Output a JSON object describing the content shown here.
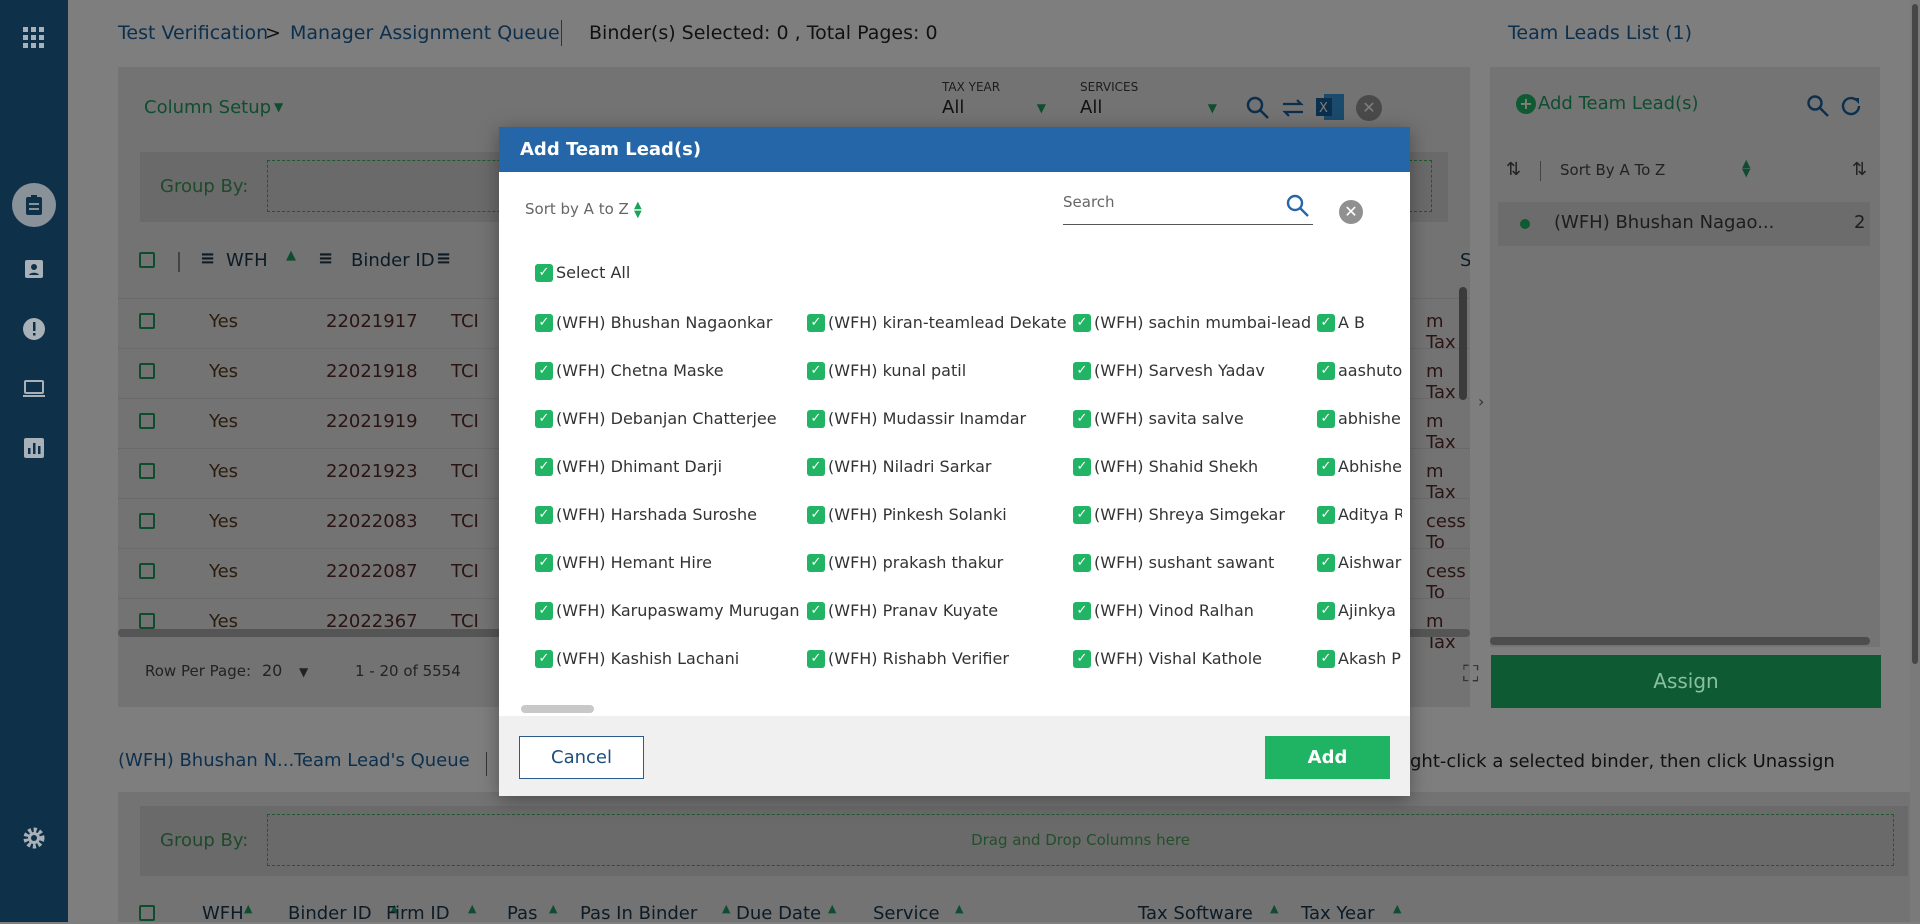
{
  "rail": {
    "icons": [
      "apps-icon",
      "assignment-icon",
      "assignment-ind-icon",
      "alert-icon",
      "laptop-icon",
      "chart-icon",
      "gear-icon"
    ]
  },
  "breadcrumb": {
    "part1": "Test Verification",
    "separator": ">",
    "part2": "Manager Assignment Queue",
    "selected": "Binder(s) Selected: 0 , Total Pages: 0"
  },
  "toolbar": {
    "column_setup": "Column Setup",
    "tax_year_label": "TAX YEAR",
    "tax_year_value": "All",
    "services_label": "SERVICES",
    "services_value": "All"
  },
  "grid": {
    "group_by": "Group By:",
    "headers": {
      "wfh": "WFH",
      "binder_id": "Binder ID",
      "softw": "Softw"
    },
    "rows": [
      {
        "wfh": "Yes",
        "binder": "22021917",
        "firm": "TCI",
        "soft": "m Tax"
      },
      {
        "wfh": "Yes",
        "binder": "22021918",
        "firm": "TCI",
        "soft": "m Tax"
      },
      {
        "wfh": "Yes",
        "binder": "22021919",
        "firm": "TCI",
        "soft": "m Tax"
      },
      {
        "wfh": "Yes",
        "binder": "22021923",
        "firm": "TCI",
        "soft": "m Tax"
      },
      {
        "wfh": "Yes",
        "binder": "22022083",
        "firm": "TCI",
        "soft": "cess To"
      },
      {
        "wfh": "Yes",
        "binder": "22022087",
        "firm": "TCI",
        "soft": "cess To"
      },
      {
        "wfh": "Yes",
        "binder": "22022367",
        "firm": "TCI",
        "soft": "m Tax"
      }
    ],
    "row_per_page_label": "Row Per Page:",
    "row_per_page": "20",
    "range": "1 - 20 of 5554"
  },
  "right_panel": {
    "title": "Team Leads List (1)",
    "add": "Add Team Lead(s)",
    "sort": "Sort By A To Z",
    "item_name": "(WFH) Bhushan Nagao...",
    "item_count": "2",
    "assign": "Assign"
  },
  "bottom": {
    "lead": "(WFH) Bhushan N...",
    "queue": "Team Lead's Queue",
    "hint": "ght-click a selected binder, then click Unassign",
    "group_by": "Group By:",
    "drop": "Drag and Drop Columns here",
    "headers": [
      "WFH",
      "Binder ID",
      "Firm ID",
      "Pas",
      "Pas In Binder",
      "Due Date",
      "Service",
      "Tax Software",
      "Tax Year"
    ]
  },
  "modal": {
    "title": "Add Team Lead(s)",
    "sort": "Sort by A to Z",
    "search_placeholder": "Search",
    "select_all": "Select All",
    "columns": [
      [
        "(WFH) Bhushan Nagaonkar",
        "(WFH) Chetna Maske",
        "(WFH) Debanjan Chatterjee",
        "(WFH) Dhimant Darji",
        "(WFH) Harshada Suroshe",
        "(WFH) Hemant Hire",
        "(WFH) Karupaswamy Murugan",
        "(WFH) Kashish Lachani"
      ],
      [
        "(WFH) kiran-teamlead Dekate",
        "(WFH) kunal patil",
        "(WFH) Mudassir Inamdar",
        "(WFH) Niladri Sarkar",
        "(WFH) Pinkesh Solanki",
        "(WFH) prakash thakur",
        "(WFH) Pranav Kuyate",
        "(WFH) Rishabh Verifier"
      ],
      [
        "(WFH) sachin mumbai-lead",
        "(WFH) Sarvesh Yadav",
        "(WFH) savita salve",
        "(WFH) Shahid Shekh",
        "(WFH) Shreya Simgekar",
        "(WFH) sushant sawant",
        "(WFH) Vinod Ralhan",
        "(WFH) Vishal Kathole"
      ],
      [
        "A B",
        "aashuto",
        "abhishel",
        "Abhishel",
        "Aditya R",
        "Aishwar",
        "Ajinkya (",
        "Akash Pu"
      ]
    ],
    "cancel": "Cancel",
    "add": "Add"
  }
}
